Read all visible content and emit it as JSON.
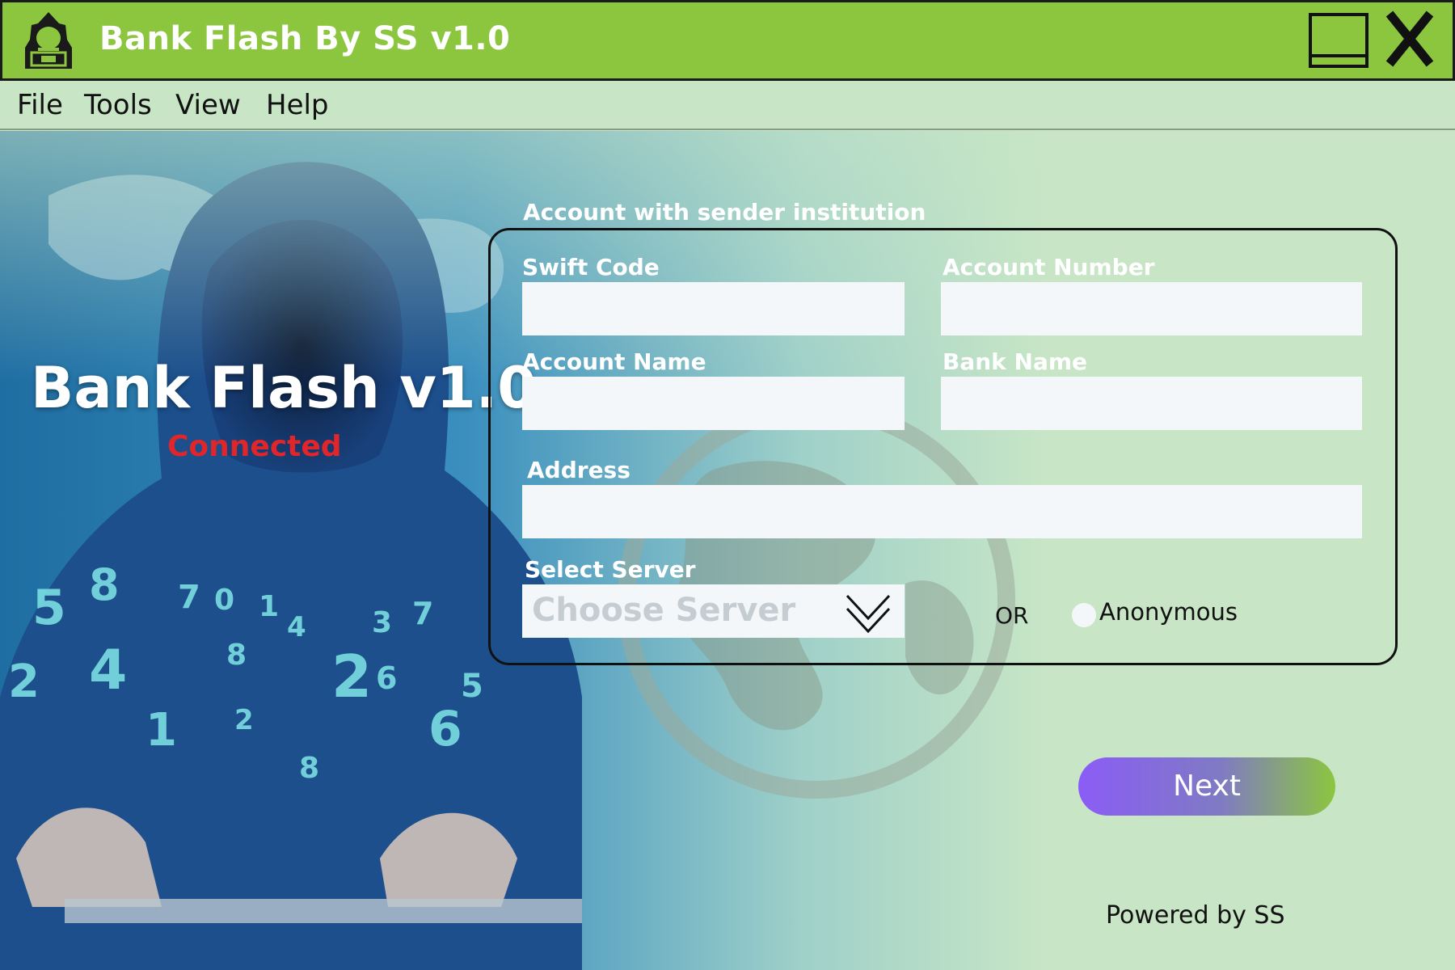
{
  "window": {
    "title": "Bank Flash By SS v1.0",
    "icons": {
      "logo": "hacker-icon",
      "maximize": "maximize-icon",
      "close": "close-icon"
    }
  },
  "menu": {
    "items": [
      "File",
      "Tools",
      "View",
      "Help"
    ]
  },
  "hero": {
    "title": "Bank Flash v1.0",
    "status": "Connected",
    "status_color": "#e0262b"
  },
  "form": {
    "legend": "Account with sender institution",
    "swift_code": {
      "label": "Swift Code",
      "value": ""
    },
    "account_number": {
      "label": "Account Number",
      "value": ""
    },
    "account_name": {
      "label": "Account Name",
      "value": ""
    },
    "bank_name": {
      "label": "Bank Name",
      "value": ""
    },
    "address": {
      "label": "Address",
      "value": ""
    },
    "server": {
      "label": "Select Server",
      "placeholder": "Choose Server"
    },
    "or_text": "OR",
    "anonymous_label": "Anonymous"
  },
  "actions": {
    "next_label": "Next"
  },
  "footer": {
    "powered_by": "Powered by SS"
  },
  "colors": {
    "titlebar": "#8cc63f",
    "background": "#c8e6c6",
    "button_gradient_start": "#8b5cf6",
    "button_gradient_end": "#8cc63f"
  }
}
